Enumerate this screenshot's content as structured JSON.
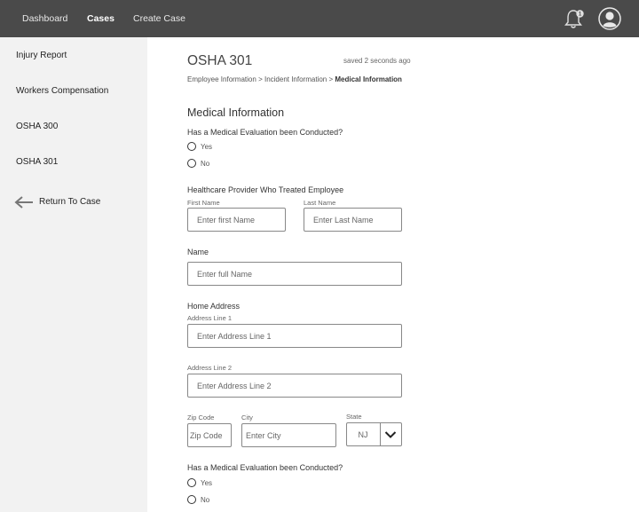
{
  "topnav": {
    "links": [
      "Dashboard",
      "Cases",
      "Create Case"
    ],
    "notification_count": "1"
  },
  "sidebar": {
    "items": [
      "Injury Report",
      "Workers Compensation",
      "OSHA 300",
      "OSHA 301"
    ],
    "return_label": "Return To Case"
  },
  "header": {
    "title": "OSHA 301",
    "saved_status": "saved 2 seconds ago"
  },
  "breadcrumb": {
    "items": [
      "Employee Information",
      "Incident Information",
      "Medical Information"
    ],
    "separator": ">"
  },
  "form": {
    "section_title": "Medical Information",
    "q1": {
      "label": "Has a Medical Evaluation been Conducted?",
      "options": [
        "Yes",
        "No"
      ]
    },
    "provider": {
      "label": "Healthcare Provider Who Treated Employee",
      "first_name_label": "First Name",
      "first_name_placeholder": "Enter first Name",
      "last_name_label": "Last Name",
      "last_name_placeholder": "Enter Last Name"
    },
    "name": {
      "label": "Name",
      "placeholder": "Enter full Name"
    },
    "address": {
      "label": "Home Address",
      "line1_label": "Address Line 1",
      "line1_placeholder": "Enter Address Line 1",
      "line2_label": "Address Line 2",
      "line2_placeholder": "Enter Address Line 2",
      "zip_label": "Zip Code",
      "zip_placeholder": "Zip Code",
      "city_label": "City",
      "city_placeholder": "Enter City",
      "state_label": "State",
      "state_value": "NJ"
    },
    "q2": {
      "label": "Has a Medical Evaluation been Conducted?",
      "options": [
        "Yes",
        "No"
      ]
    }
  },
  "colors": {
    "topbar": "#4a4a4a",
    "sidebar": "#f2f2f2",
    "input_border": "#888888"
  },
  "icons": {
    "notification": "bell-icon",
    "profile": "user-avatar-icon",
    "return": "arrow-left-icon",
    "dropdown": "chevron-down-icon"
  }
}
